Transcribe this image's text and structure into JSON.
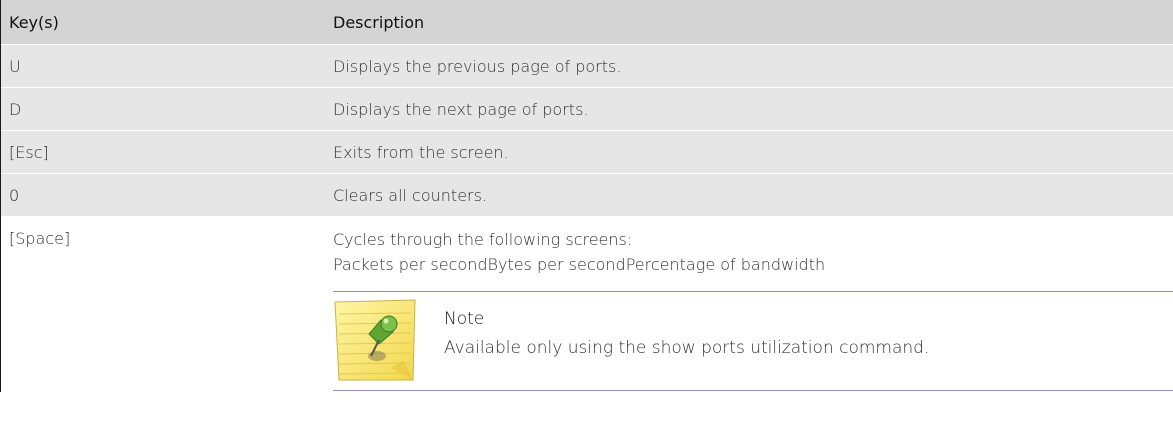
{
  "table": {
    "header": {
      "key": "Key(s)",
      "description": "Description"
    },
    "rows": [
      {
        "key": "U",
        "description": "Displays the previous page of ports."
      },
      {
        "key": "D",
        "description": "Displays the next page of ports."
      },
      {
        "key": "[Esc]",
        "description": "Exits from the screen."
      },
      {
        "key": "0",
        "description": "Clears all counters."
      }
    ],
    "last_row": {
      "key": "[Space]",
      "line1": "Cycles through the following screens:",
      "line2": "Packets per secondBytes per secondPercentage of bandwidth"
    }
  },
  "note": {
    "title": "Note",
    "text": "Available only using the show ports utilization command.",
    "icon": "note-pin-icon"
  }
}
